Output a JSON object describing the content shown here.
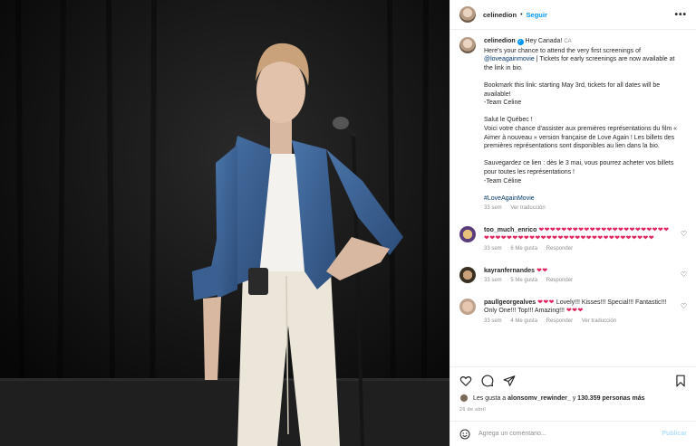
{
  "post": {
    "username": "celinedion",
    "follow_label": "Seguir",
    "more_label": "•••"
  },
  "caption": {
    "username": "celinedion",
    "region": "CA",
    "intro": "Hey Canada!",
    "p1_before_link": "Here's your chance to attend the very first screenings of ",
    "p1_link": "@loveagainmovie",
    "p1_after_link": " | Tickets for early screenings are now available at the link in bio.",
    "p2": "Bookmark this link: starting May 3rd, tickets for all dates will be available!\n-Team Celine",
    "p3": "Salut le Québec !\nVoici votre chance d'assister aux premières représentations du film « Aimer à nouveau » version française de Love Again ! Les billets des premières représentations sont disponibles au lien dans la bio.",
    "p4": "Sauvegardez ce lien : dès le 3 mai, vous pourrez acheter vos billets pour toutes les représentations !\n-Team Céline",
    "hashtag": "#LoveAgainMovie",
    "time": "33 sem",
    "translate": "Ver traducción"
  },
  "comments": [
    {
      "username": "too_much_enrico",
      "text": "❤❤❤❤❤❤❤❤❤❤❤❤❤❤❤❤❤❤❤❤❤❤❤❤❤❤❤❤❤❤❤❤❤❤❤❤❤❤❤❤❤❤❤❤❤❤❤❤❤❤❤❤❤",
      "time": "33 sem",
      "likes": "6 Me gusta",
      "reply": "Responder",
      "translate": ""
    },
    {
      "username": "kayranfernandes",
      "text": "❤❤",
      "time": "33 sem",
      "likes": "5 Me gusta",
      "reply": "Responder",
      "translate": ""
    },
    {
      "username": "paullgeorgealves",
      "text_before": "❤❤❤",
      "text": " Lovely!!! Kisses!!! Special!!! Fantastic!!! Only One!!! Top!!! Amazing!!! ",
      "text_after": "❤❤❤",
      "time": "33 sem",
      "likes": "4 Me gusta",
      "reply": "Responder",
      "translate": "Ver traducción"
    }
  ],
  "likes": {
    "prefix": "Les gusta a ",
    "first_user": "alonsomv_rewinder_",
    "middle": " y ",
    "count": "130.359 personas más"
  },
  "date": "26 de abril",
  "composer": {
    "placeholder": "Agrega un comentario...",
    "publish": "Publicar"
  },
  "icons": {
    "like": "heart-icon",
    "comment": "comment-icon",
    "share": "share-icon",
    "save": "bookmark-icon",
    "emoji": "emoji-icon",
    "more": "more-icon",
    "verified": "verified-badge-icon"
  },
  "colors": {
    "link": "#00376b",
    "follow": "#0095f6",
    "heart": "#e0245e",
    "muted": "#8e8e8e"
  }
}
